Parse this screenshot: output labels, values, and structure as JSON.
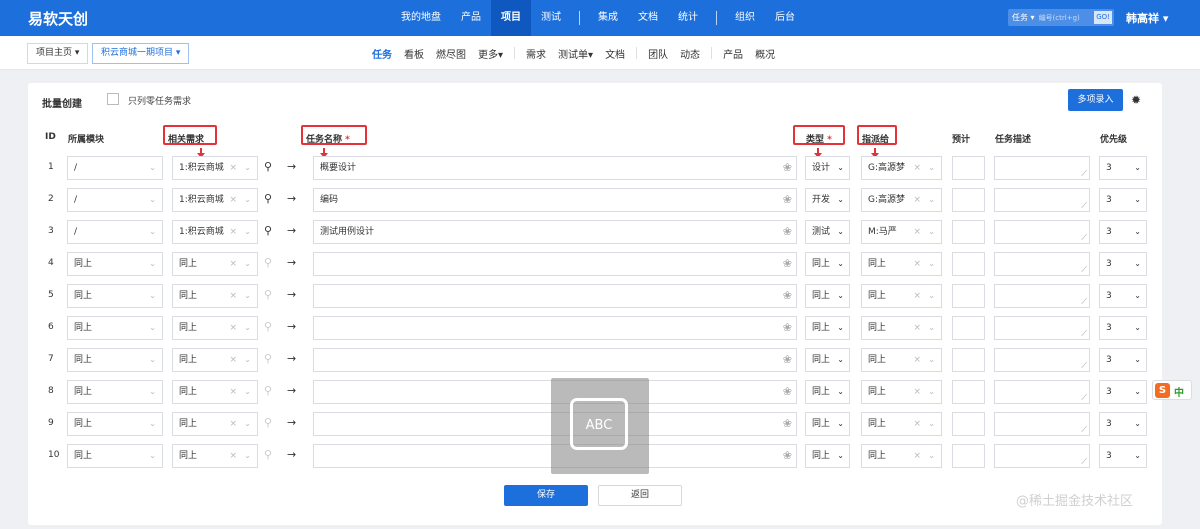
{
  "app": {
    "logo": "易软天创",
    "user": "韩高祥 ▾"
  },
  "nav": [
    {
      "label": "我的地盘"
    },
    {
      "label": "产品"
    },
    {
      "label": "项目",
      "active": true
    },
    {
      "label": "测试"
    },
    {
      "sep": true
    },
    {
      "label": "集成"
    },
    {
      "label": "文档"
    },
    {
      "label": "统计"
    },
    {
      "sep": true
    },
    {
      "label": "组织"
    },
    {
      "label": "后台"
    }
  ],
  "search": {
    "type": "任务 ▾",
    "placeholder": "编号(ctrl+g)",
    "go": "GO!"
  },
  "breadcrumb": {
    "home": "项目主页 ▾",
    "project": "积云商城一期项目 ▾"
  },
  "subnav": [
    {
      "label": "任务",
      "active": true
    },
    {
      "label": "看板"
    },
    {
      "label": "燃尽图"
    },
    {
      "label": "更多▾"
    },
    {
      "sep": true
    },
    {
      "label": "需求"
    },
    {
      "label": "测试单▾"
    },
    {
      "label": "文档"
    },
    {
      "sep": true
    },
    {
      "label": "团队"
    },
    {
      "label": "动态"
    },
    {
      "sep": true
    },
    {
      "label": "产品"
    },
    {
      "label": "概况"
    }
  ],
  "panel": {
    "title": "批量创建",
    "checkbox_label": "只列零任务需求",
    "multi_button": "多项录入",
    "settings_icon": "gear-icon"
  },
  "headers": {
    "id": "ID",
    "module": "所属模块",
    "story": "相关需求",
    "name": "任务名称",
    "type": "类型",
    "assign": "指派给",
    "estimate": "预计",
    "desc": "任务描述",
    "pri": "优先级"
  },
  "rows": [
    {
      "id": "1",
      "module": "/",
      "story": "1:积云商城",
      "name": "概要设计",
      "type": "设计",
      "assign": "G:高源梦",
      "pri": "3"
    },
    {
      "id": "2",
      "module": "/",
      "story": "1:积云商城",
      "name": "编码",
      "type": "开发",
      "assign": "G:高源梦",
      "pri": "3"
    },
    {
      "id": "3",
      "module": "/",
      "story": "1:积云商城",
      "name": "测试用例设计",
      "type": "测试",
      "assign": "M:马严",
      "pri": "3"
    },
    {
      "id": "4",
      "module": "同上",
      "story": "同上",
      "name": "",
      "type": "同上",
      "assign": "同上",
      "pri": "3"
    },
    {
      "id": "5",
      "module": "同上",
      "story": "同上",
      "name": "",
      "type": "同上",
      "assign": "同上",
      "pri": "3"
    },
    {
      "id": "6",
      "module": "同上",
      "story": "同上",
      "name": "",
      "type": "同上",
      "assign": "同上",
      "pri": "3"
    },
    {
      "id": "7",
      "module": "同上",
      "story": "同上",
      "name": "",
      "type": "同上",
      "assign": "同上",
      "pri": "3"
    },
    {
      "id": "8",
      "module": "同上",
      "story": "同上",
      "name": "",
      "type": "同上",
      "assign": "同上",
      "pri": "3"
    },
    {
      "id": "9",
      "module": "同上",
      "story": "同上",
      "name": "",
      "type": "同上",
      "assign": "同上",
      "pri": "3"
    },
    {
      "id": "10",
      "module": "同上",
      "story": "同上",
      "name": "",
      "type": "同上",
      "assign": "同上",
      "pri": "3"
    }
  ],
  "buttons": {
    "save": "保存",
    "back": "返回"
  },
  "ime": {
    "label": "ABC",
    "sogou_s": "S",
    "sogou_zh": "中"
  },
  "watermark": "@稀土掘金技术社区",
  "colors": {
    "accent": "#1d6fdc",
    "annotation": "#e53238"
  }
}
